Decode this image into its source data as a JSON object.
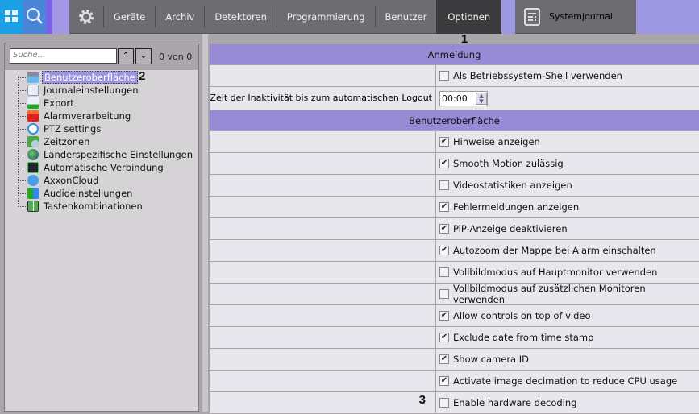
{
  "nav": {
    "tabs": [
      "Geräte",
      "Archiv",
      "Detektoren",
      "Programmierung",
      "Benutzer",
      "Optionen"
    ],
    "active": "Optionen",
    "systemjournal": "Systemjournal"
  },
  "annotations": {
    "n1": "1",
    "n2": "2",
    "n3": "3"
  },
  "left": {
    "search_placeholder": "Suche...",
    "count": "0 von 0",
    "up": "^",
    "down": "v",
    "items": [
      "Benutzeroberfläche",
      "Journaleinstellungen",
      "Export",
      "Alarmverarbeitung",
      "PTZ settings",
      "Zeitzonen",
      "Länderspezifische Einstellungen",
      "Automatische Verbindung",
      "AxxonCloud",
      "Audioeinstellungen",
      "Tastenkombinationen"
    ]
  },
  "main": {
    "sec1": "Anmeldung",
    "shell": {
      "label": "Als Betriebssystem-Shell verwenden",
      "checked": false
    },
    "logout": {
      "label": "Zeit der Inaktivität bis zum automatischen Logout",
      "value": "00:00"
    },
    "sec2": "Benutzeroberfläche",
    "options": [
      {
        "label": "Hinweise anzeigen",
        "checked": true
      },
      {
        "label": "Smooth Motion zulässig",
        "checked": true
      },
      {
        "label": "Videostatistiken anzeigen",
        "checked": false
      },
      {
        "label": "Fehlermeldungen anzeigen",
        "checked": true
      },
      {
        "label": "PiP-Anzeige deaktivieren",
        "checked": true
      },
      {
        "label": "Autozoom der Mappe bei Alarm einschalten",
        "checked": true
      },
      {
        "label": "Vollbildmodus auf Hauptmonitor verwenden",
        "checked": false
      },
      {
        "label": "Vollbildmodus auf zusätzlichen Monitoren verwenden",
        "checked": false
      },
      {
        "label": "Allow controls on top of video",
        "checked": true
      },
      {
        "label": "Exclude date from time stamp",
        "checked": true
      },
      {
        "label": "Show camera ID",
        "checked": true
      },
      {
        "label": "Activate image decimation to reduce CPU usage",
        "checked": true
      },
      {
        "label": "Enable hardware decoding",
        "checked": false
      }
    ]
  }
}
